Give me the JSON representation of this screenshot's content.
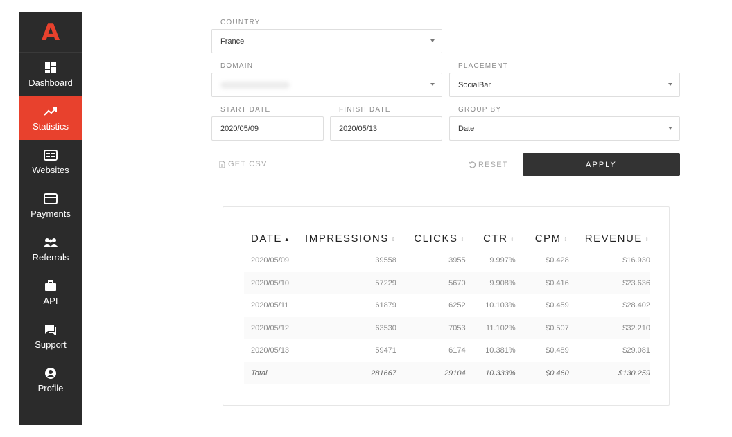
{
  "sidebar": {
    "logo": "A",
    "items": [
      {
        "label": "Dashboard",
        "icon": "dashboard-icon"
      },
      {
        "label": "Statistics",
        "icon": "trending-up-icon",
        "active": true
      },
      {
        "label": "Websites",
        "icon": "website-icon"
      },
      {
        "label": "Payments",
        "icon": "credit-card-icon"
      },
      {
        "label": "Referrals",
        "icon": "people-icon"
      },
      {
        "label": "API",
        "icon": "briefcase-icon"
      },
      {
        "label": "Support",
        "icon": "chat-icon"
      },
      {
        "label": "Profile",
        "icon": "user-circle-icon"
      }
    ]
  },
  "form": {
    "country": {
      "label": "COUNTRY",
      "value": "France"
    },
    "domain": {
      "label": "DOMAIN",
      "value": ""
    },
    "placement": {
      "label": "PLACEMENT",
      "value": "SocialBar"
    },
    "start_date": {
      "label": "START DATE",
      "value": "2020/05/09"
    },
    "finish_date": {
      "label": "FINISH DATE",
      "value": "2020/05/13"
    },
    "group_by": {
      "label": "GROUP BY",
      "value": "Date"
    },
    "get_csv": "GET CSV",
    "reset": "RESET",
    "apply": "APPLY"
  },
  "table": {
    "columns": [
      "DATE",
      "IMPRESSIONS",
      "CLICKS",
      "CTR",
      "CPM",
      "REVENUE"
    ],
    "rows": [
      [
        "2020/05/09",
        "39558",
        "3955",
        "9.997%",
        "$0.428",
        "$16.930"
      ],
      [
        "2020/05/10",
        "57229",
        "5670",
        "9.908%",
        "$0.416",
        "$23.636"
      ],
      [
        "2020/05/11",
        "61879",
        "6252",
        "10.103%",
        "$0.459",
        "$28.402"
      ],
      [
        "2020/05/12",
        "63530",
        "7053",
        "11.102%",
        "$0.507",
        "$32.210"
      ],
      [
        "2020/05/13",
        "59471",
        "6174",
        "10.381%",
        "$0.489",
        "$29.081"
      ]
    ],
    "total": [
      "Total",
      "281667",
      "29104",
      "10.333%",
      "$0.460",
      "$130.259"
    ]
  },
  "colors": {
    "accent": "#e8412d",
    "sidebar": "#2b2b2b",
    "button": "#333333"
  }
}
